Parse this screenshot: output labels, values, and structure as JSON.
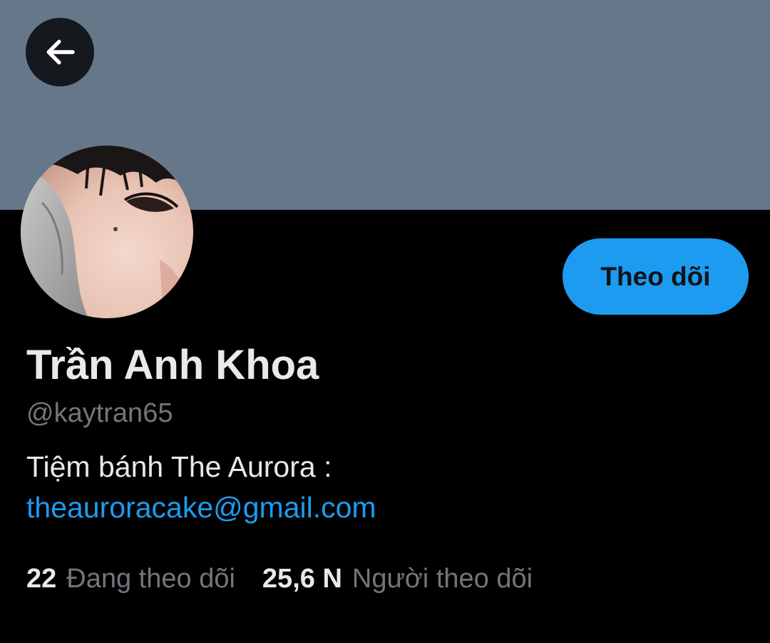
{
  "profile": {
    "display_name": "Trần Anh Khoa",
    "handle": "@kaytran65",
    "bio_text": "Tiệm bánh The Aurora :",
    "bio_link": "theauroracake@gmail.com"
  },
  "actions": {
    "follow_label": "Theo dõi"
  },
  "stats": {
    "following_count": "22",
    "following_label": "Đang theo dõi",
    "followers_count": "25,6 N",
    "followers_label": "Người theo dõi"
  },
  "icons": {
    "back": "arrow-left-icon"
  },
  "colors": {
    "banner": "#66778a",
    "background": "#000000",
    "accent": "#1d9bf0",
    "primary_text": "#e7e9ea",
    "secondary_text": "#71767b"
  }
}
